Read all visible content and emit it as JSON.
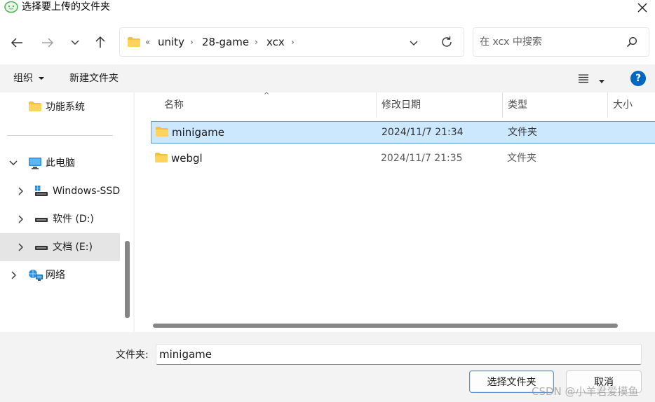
{
  "window": {
    "title": "选择要上传的文件夹",
    "colors": {
      "accent": "#0067c0",
      "selection": "#cce8ff",
      "selection_border": "#5da0d8",
      "folder": "#f4c042"
    }
  },
  "navigation": {
    "breadcrumb_overflow": "«",
    "breadcrumbs": [
      "unity",
      "28-game",
      "xcx"
    ],
    "search_placeholder": "在 xcx 中搜索"
  },
  "commandbar": {
    "organize_label": "组织",
    "new_folder_label": "新建文件夹",
    "help_label": "?"
  },
  "sidebar": {
    "items": [
      {
        "label": "功能系统",
        "icon": "folder-icon"
      },
      {
        "label": "此电脑",
        "icon": "computer-icon"
      },
      {
        "label": "Windows-SSD",
        "icon": "windows-drive-icon"
      },
      {
        "label": "软件 (D:)",
        "icon": "drive-icon"
      },
      {
        "label": "文档 (E:)",
        "icon": "drive-icon"
      },
      {
        "label": "网络",
        "icon": "network-icon"
      }
    ]
  },
  "filelist": {
    "columns": [
      "名称",
      "修改日期",
      "类型",
      "大小"
    ],
    "rows": [
      {
        "name": "minigame",
        "date": "2024/11/7 21:34",
        "type": "文件夹"
      },
      {
        "name": "webgl",
        "date": "2024/11/7 21:35",
        "type": "文件夹"
      }
    ]
  },
  "footer": {
    "folder_label": "文件夹:",
    "folder_value": "minigame",
    "select_button": "选择文件夹",
    "cancel_button": "取消",
    "watermark": "CSDN @小羊君爱摸鱼"
  }
}
